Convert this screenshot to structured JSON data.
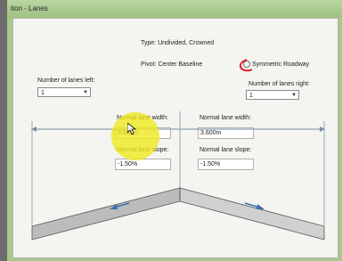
{
  "window": {
    "title": "tion - Lanes"
  },
  "type_text": "Type:  Undivided, Crowned",
  "pivot_text": "Pivot:  Center Baseline",
  "symmetric_label": "Symmetric Roadway",
  "lanes_left": {
    "label": "Number of lanes left:",
    "value": "1"
  },
  "lanes_right": {
    "label": "Number of lanes right:",
    "value": "1"
  },
  "left_lane": {
    "width_label": "Normal lane width:",
    "width_value": "3.600m",
    "slope_label": "Normal lane slope:",
    "slope_value": "-1.50%"
  },
  "right_lane": {
    "width_label": "Normal lane width:",
    "width_value": "3.600m",
    "slope_label": "Normal lane slope:",
    "slope_value": "-1.50%"
  },
  "colors": {
    "annotation_red": "#e0202a",
    "cursor_highlight": "#eee81e",
    "arrow_blue": "#3d6fb4",
    "dimension_line": "#7a8ca0"
  }
}
